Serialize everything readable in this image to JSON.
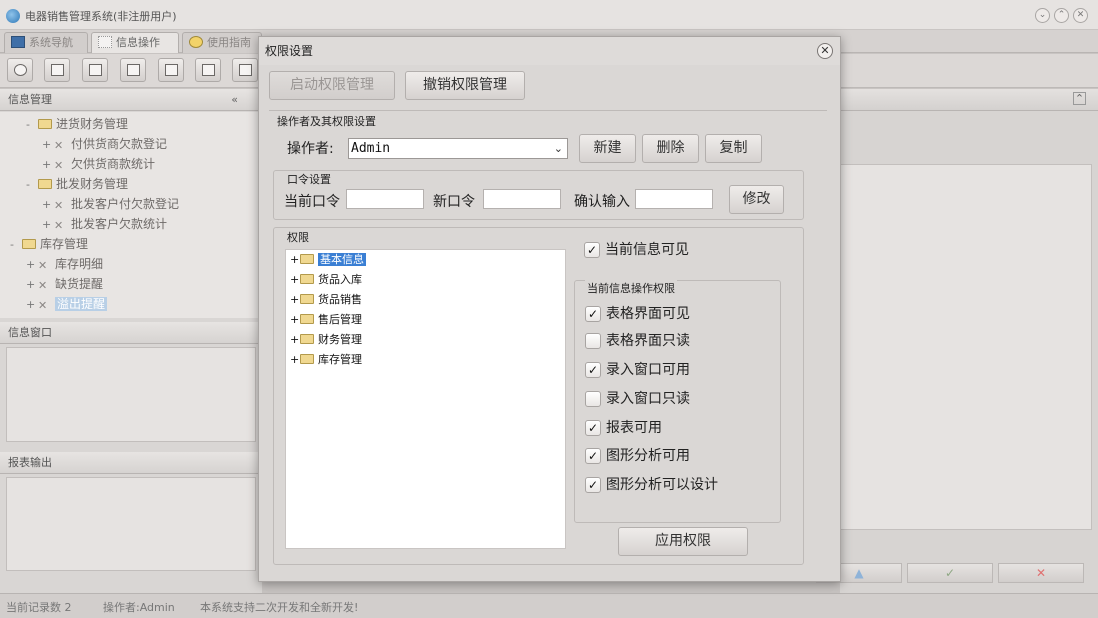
{
  "app": {
    "title": "电器销售管理系统(非注册用户)",
    "tabs": [
      {
        "label": "系统导航"
      },
      {
        "label": "信息操作"
      },
      {
        "label": "使用指南"
      }
    ]
  },
  "left_panel": {
    "info_header": "信息管理",
    "tree": [
      {
        "toggle": "-",
        "icon": "folder",
        "label": "进货财务管理"
      },
      {
        "toggle": "+",
        "icon": "tool",
        "label": "付供货商欠款登记"
      },
      {
        "toggle": "+",
        "icon": "tool",
        "label": "欠供货商款统计"
      },
      {
        "toggle": "-",
        "icon": "folder",
        "label": "批发财务管理"
      },
      {
        "toggle": "+",
        "icon": "tool",
        "label": "批发客户付欠款登记"
      },
      {
        "toggle": "+",
        "icon": "tool",
        "label": "批发客户欠款统计"
      },
      {
        "toggle": "-",
        "icon": "folder",
        "label": "库存管理"
      },
      {
        "toggle": "+",
        "icon": "tool",
        "label": "库存明细"
      },
      {
        "toggle": "+",
        "icon": "tool",
        "label": "缺货提醒"
      },
      {
        "toggle": "+",
        "icon": "tool",
        "label": "溢出提醒"
      }
    ],
    "info_window_header": "信息窗口",
    "report_header": "报表输出"
  },
  "status_bar": {
    "record_count": "当前记录数 2",
    "operator": "操作者:Admin",
    "message": "本系统支持二次开发和全新开发!"
  },
  "dialog": {
    "title": "权限设置",
    "close_glyph": "✕",
    "enable_button": "启动权限管理",
    "revoke_button": "撤销权限管理",
    "operator_group_label": "操作者及其权限设置",
    "operator_label": "操作者:",
    "operator_value": "Admin",
    "new_button": "新建",
    "delete_button": "删除",
    "copy_button": "复制",
    "password_group_label": "口令设置",
    "current_password_label": "当前口令",
    "new_password_label": "新口令",
    "confirm_label": "确认输入",
    "modify_button": "修改",
    "permission_group_label": "权限",
    "permission_tree": [
      {
        "toggle": "+",
        "label": "基本信息",
        "selected": true
      },
      {
        "toggle": "+",
        "label": "货品入库",
        "selected": false
      },
      {
        "toggle": "+",
        "label": "货品销售",
        "selected": false
      },
      {
        "toggle": "+",
        "label": "售后管理",
        "selected": false
      },
      {
        "toggle": "+",
        "label": "财务管理",
        "selected": false
      },
      {
        "toggle": "+",
        "label": "库存管理",
        "selected": false
      }
    ],
    "current_info_visible": {
      "label": "当前信息可见",
      "checked": true
    },
    "ops_group_label": "当前信息操作权限",
    "ops": [
      {
        "label": "表格界面可见",
        "checked": true
      },
      {
        "label": "表格界面只读",
        "checked": false
      },
      {
        "label": "录入窗口可用",
        "checked": true
      },
      {
        "label": "录入窗口只读",
        "checked": false
      },
      {
        "label": "报表可用",
        "checked": true
      },
      {
        "label": "图形分析可用",
        "checked": true
      },
      {
        "label": "图形分析可以设计",
        "checked": true
      }
    ],
    "apply_button": "应用权限"
  }
}
